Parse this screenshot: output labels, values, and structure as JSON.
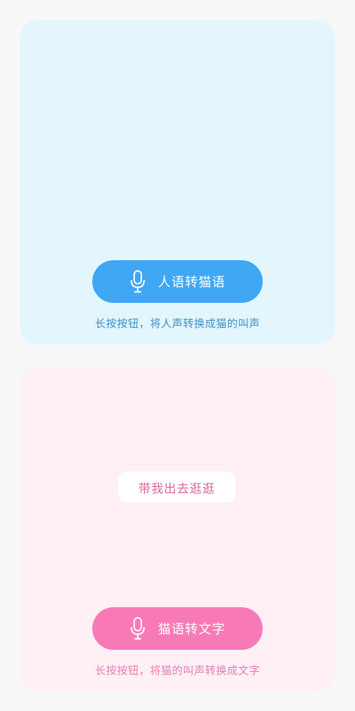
{
  "human_to_cat": {
    "button_label": "人语转猫语",
    "hint": "长按按钮，将人声转换成猫的叫声",
    "accent_color": "#3fa7f3",
    "icon": "microphone-icon"
  },
  "cat_to_text": {
    "result_text": "带我出去逛逛",
    "button_label": "猫语转文字",
    "hint": "长按按钮，将猫的叫声转换成文字",
    "accent_color": "#f77ab7",
    "icon": "microphone-icon"
  }
}
